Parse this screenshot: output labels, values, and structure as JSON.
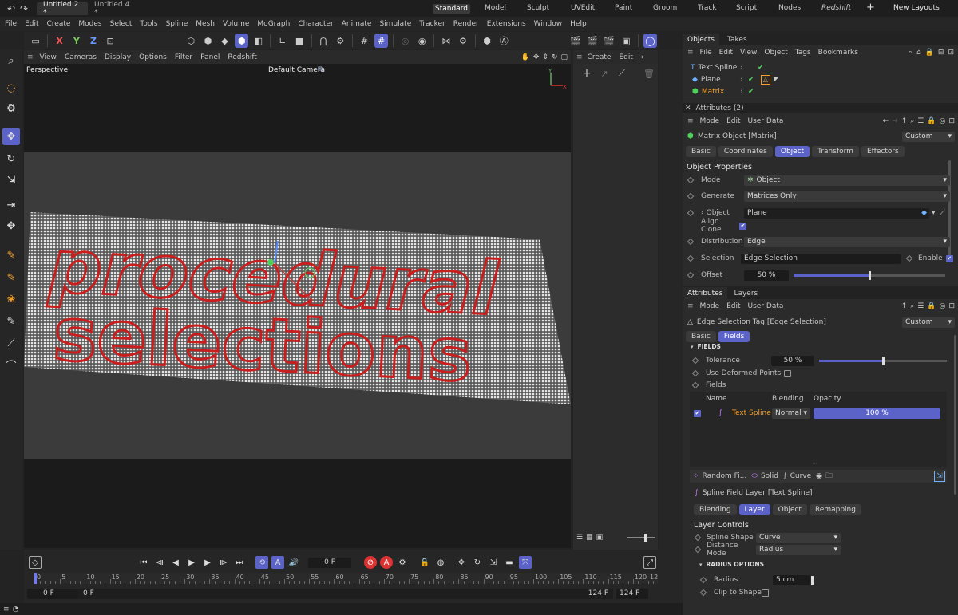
{
  "titlebar": {
    "tabs": [
      {
        "label": "Untitled 2 *"
      },
      {
        "label": "Untitled 4 *"
      }
    ],
    "layouts": [
      "Standard",
      "Model",
      "Sculpt",
      "UVEdit",
      "Paint",
      "Groom",
      "Track",
      "Script",
      "Nodes",
      "Redshift"
    ],
    "new_layouts": "New Layouts"
  },
  "menubar": [
    "File",
    "Edit",
    "Create",
    "Modes",
    "Select",
    "Tools",
    "Spline",
    "Mesh",
    "Volume",
    "MoGraph",
    "Character",
    "Animate",
    "Simulate",
    "Tracker",
    "Render",
    "Extensions",
    "Window",
    "Help"
  ],
  "toolbar": {
    "axis": [
      "X",
      "Y",
      "Z"
    ]
  },
  "viewport": {
    "menu": [
      "View",
      "Cameras",
      "Display",
      "Options",
      "Filter",
      "Panel",
      "Redshift"
    ],
    "name": "Perspective",
    "camera": "Default Camera",
    "line1": "procedural",
    "line2": "selections",
    "axis_x": "X",
    "axis_y": "Y"
  },
  "midpanel": {
    "menu": [
      "Create",
      "Edit"
    ]
  },
  "objects": {
    "tabs": [
      "Objects",
      "Takes"
    ],
    "menu": [
      "File",
      "Edit",
      "View",
      "Object",
      "Tags",
      "Bookmarks"
    ],
    "items": [
      {
        "name": "Text Spline"
      },
      {
        "name": "Plane"
      },
      {
        "name": "Matrix"
      }
    ]
  },
  "attributes_top": {
    "header": "Attributes (2)",
    "menu": [
      "Mode",
      "Edit",
      "User Data"
    ],
    "object_title": "Matrix Object [Matrix]",
    "preset": "Custom",
    "tabs": [
      "Basic",
      "Coordinates",
      "Object",
      "Transform",
      "Effectors"
    ],
    "section": "Object Properties",
    "props": {
      "mode_label": "Mode",
      "mode_value": "Object",
      "generate_label": "Generate",
      "generate_value": "Matrices Only",
      "object_label": "Object",
      "object_value": "Plane",
      "align_label": "Align Clone",
      "distribution_label": "Distribution",
      "distribution_value": "Edge",
      "selection_label": "Selection",
      "selection_value": "Edge Selection",
      "enable_label": "Enable",
      "offset_label": "Offset",
      "offset_value": "50 %",
      "offset_fraction": 0.5
    }
  },
  "attributes_bottom": {
    "tabs": [
      "Attributes",
      "Layers"
    ],
    "menu": [
      "Mode",
      "Edit",
      "User Data"
    ],
    "tag_title": "Edge Selection Tag [Edge Selection]",
    "preset": "Custom",
    "subtabs": [
      "Basic",
      "Fields"
    ],
    "fields_header": "FIELDS",
    "tolerance_label": "Tolerance",
    "tolerance_value": "50 %",
    "tolerance_fraction": 0.5,
    "deformed_label": "Use Deformed Points",
    "fields_label": "Fields",
    "list_headers": [
      "Name",
      "Blending",
      "Opacity"
    ],
    "list_row": {
      "name": "Text Spline",
      "blending": "Normal",
      "opacity": "100 %"
    },
    "field_buttons": [
      "Random Fi...",
      "Solid",
      "Curve"
    ],
    "layer_title": "Spline Field Layer [Text Spline]",
    "layer_tabs": [
      "Blending",
      "Layer",
      "Object",
      "Remapping"
    ],
    "layer_controls": "Layer Controls",
    "spline_shape_label": "Spline Shape",
    "spline_shape_value": "Curve",
    "distance_mode_label": "Distance Mode",
    "distance_mode_value": "Radius",
    "radius_header": "RADIUS OPTIONS",
    "radius_label": "Radius",
    "radius_value": "5 cm",
    "clip_label": "Clip to Shape"
  },
  "timeline": {
    "current_frame": "0 F",
    "ticks": [
      "0",
      "5",
      "10",
      "15",
      "20",
      "25",
      "30",
      "35",
      "40",
      "45",
      "50",
      "55",
      "60",
      "65",
      "70",
      "75",
      "80",
      "85",
      "90",
      "95",
      "100",
      "105",
      "110",
      "115",
      "120"
    ],
    "last_tick": "12",
    "start": "0 F",
    "start2": "0 F",
    "end": "124 F",
    "end2": "124 F"
  },
  "colors": {
    "accent": "#5b63c9",
    "text_red": "#c81e1e",
    "icon_blue": "#6fb2ff",
    "green": "#4fd05a"
  }
}
